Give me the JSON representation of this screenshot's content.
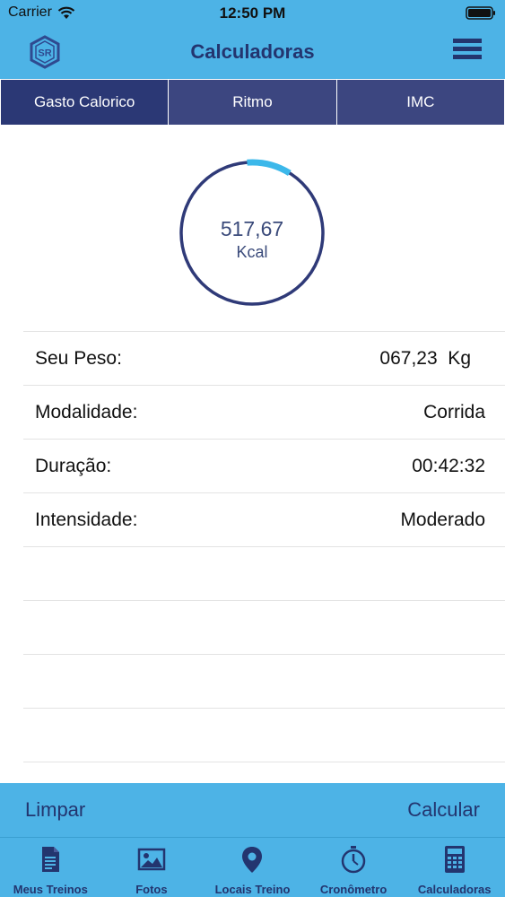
{
  "status_bar": {
    "carrier": "Carrier",
    "time": "12:50 PM"
  },
  "nav": {
    "title": "Calculadoras",
    "logo_text": "SR"
  },
  "tabs": [
    {
      "label": "Gasto Calorico",
      "active": true
    },
    {
      "label": "Ritmo",
      "active": false
    },
    {
      "label": "IMC",
      "active": false
    }
  ],
  "gauge": {
    "value": "517,67",
    "unit": "Kcal",
    "progress_fraction": 0.1
  },
  "fields": [
    {
      "label": "Seu Peso:",
      "value": "067,23  Kg"
    },
    {
      "label": "Modalidade:",
      "value": "Corrida"
    },
    {
      "label": "Duração:",
      "value": "00:42:32"
    },
    {
      "label": "Intensidade:",
      "value": "Moderado"
    }
  ],
  "actions": {
    "clear_label": "Limpar",
    "calculate_label": "Calcular"
  },
  "tabbar": [
    {
      "label": "Meus Treinos",
      "icon": "document-icon"
    },
    {
      "label": "Fotos",
      "icon": "photo-icon"
    },
    {
      "label": "Locais Treino",
      "icon": "location-pin-icon"
    },
    {
      "label": "Cronômetro",
      "icon": "stopwatch-icon"
    },
    {
      "label": "Calculadoras",
      "icon": "calculator-icon"
    }
  ],
  "colors": {
    "primary_blue": "#4db3e6",
    "navy": "#23356f",
    "tab_bg": "#3c4680",
    "gauge_ring": "#2f3a78",
    "gauge_progress": "#3cb8ea"
  }
}
